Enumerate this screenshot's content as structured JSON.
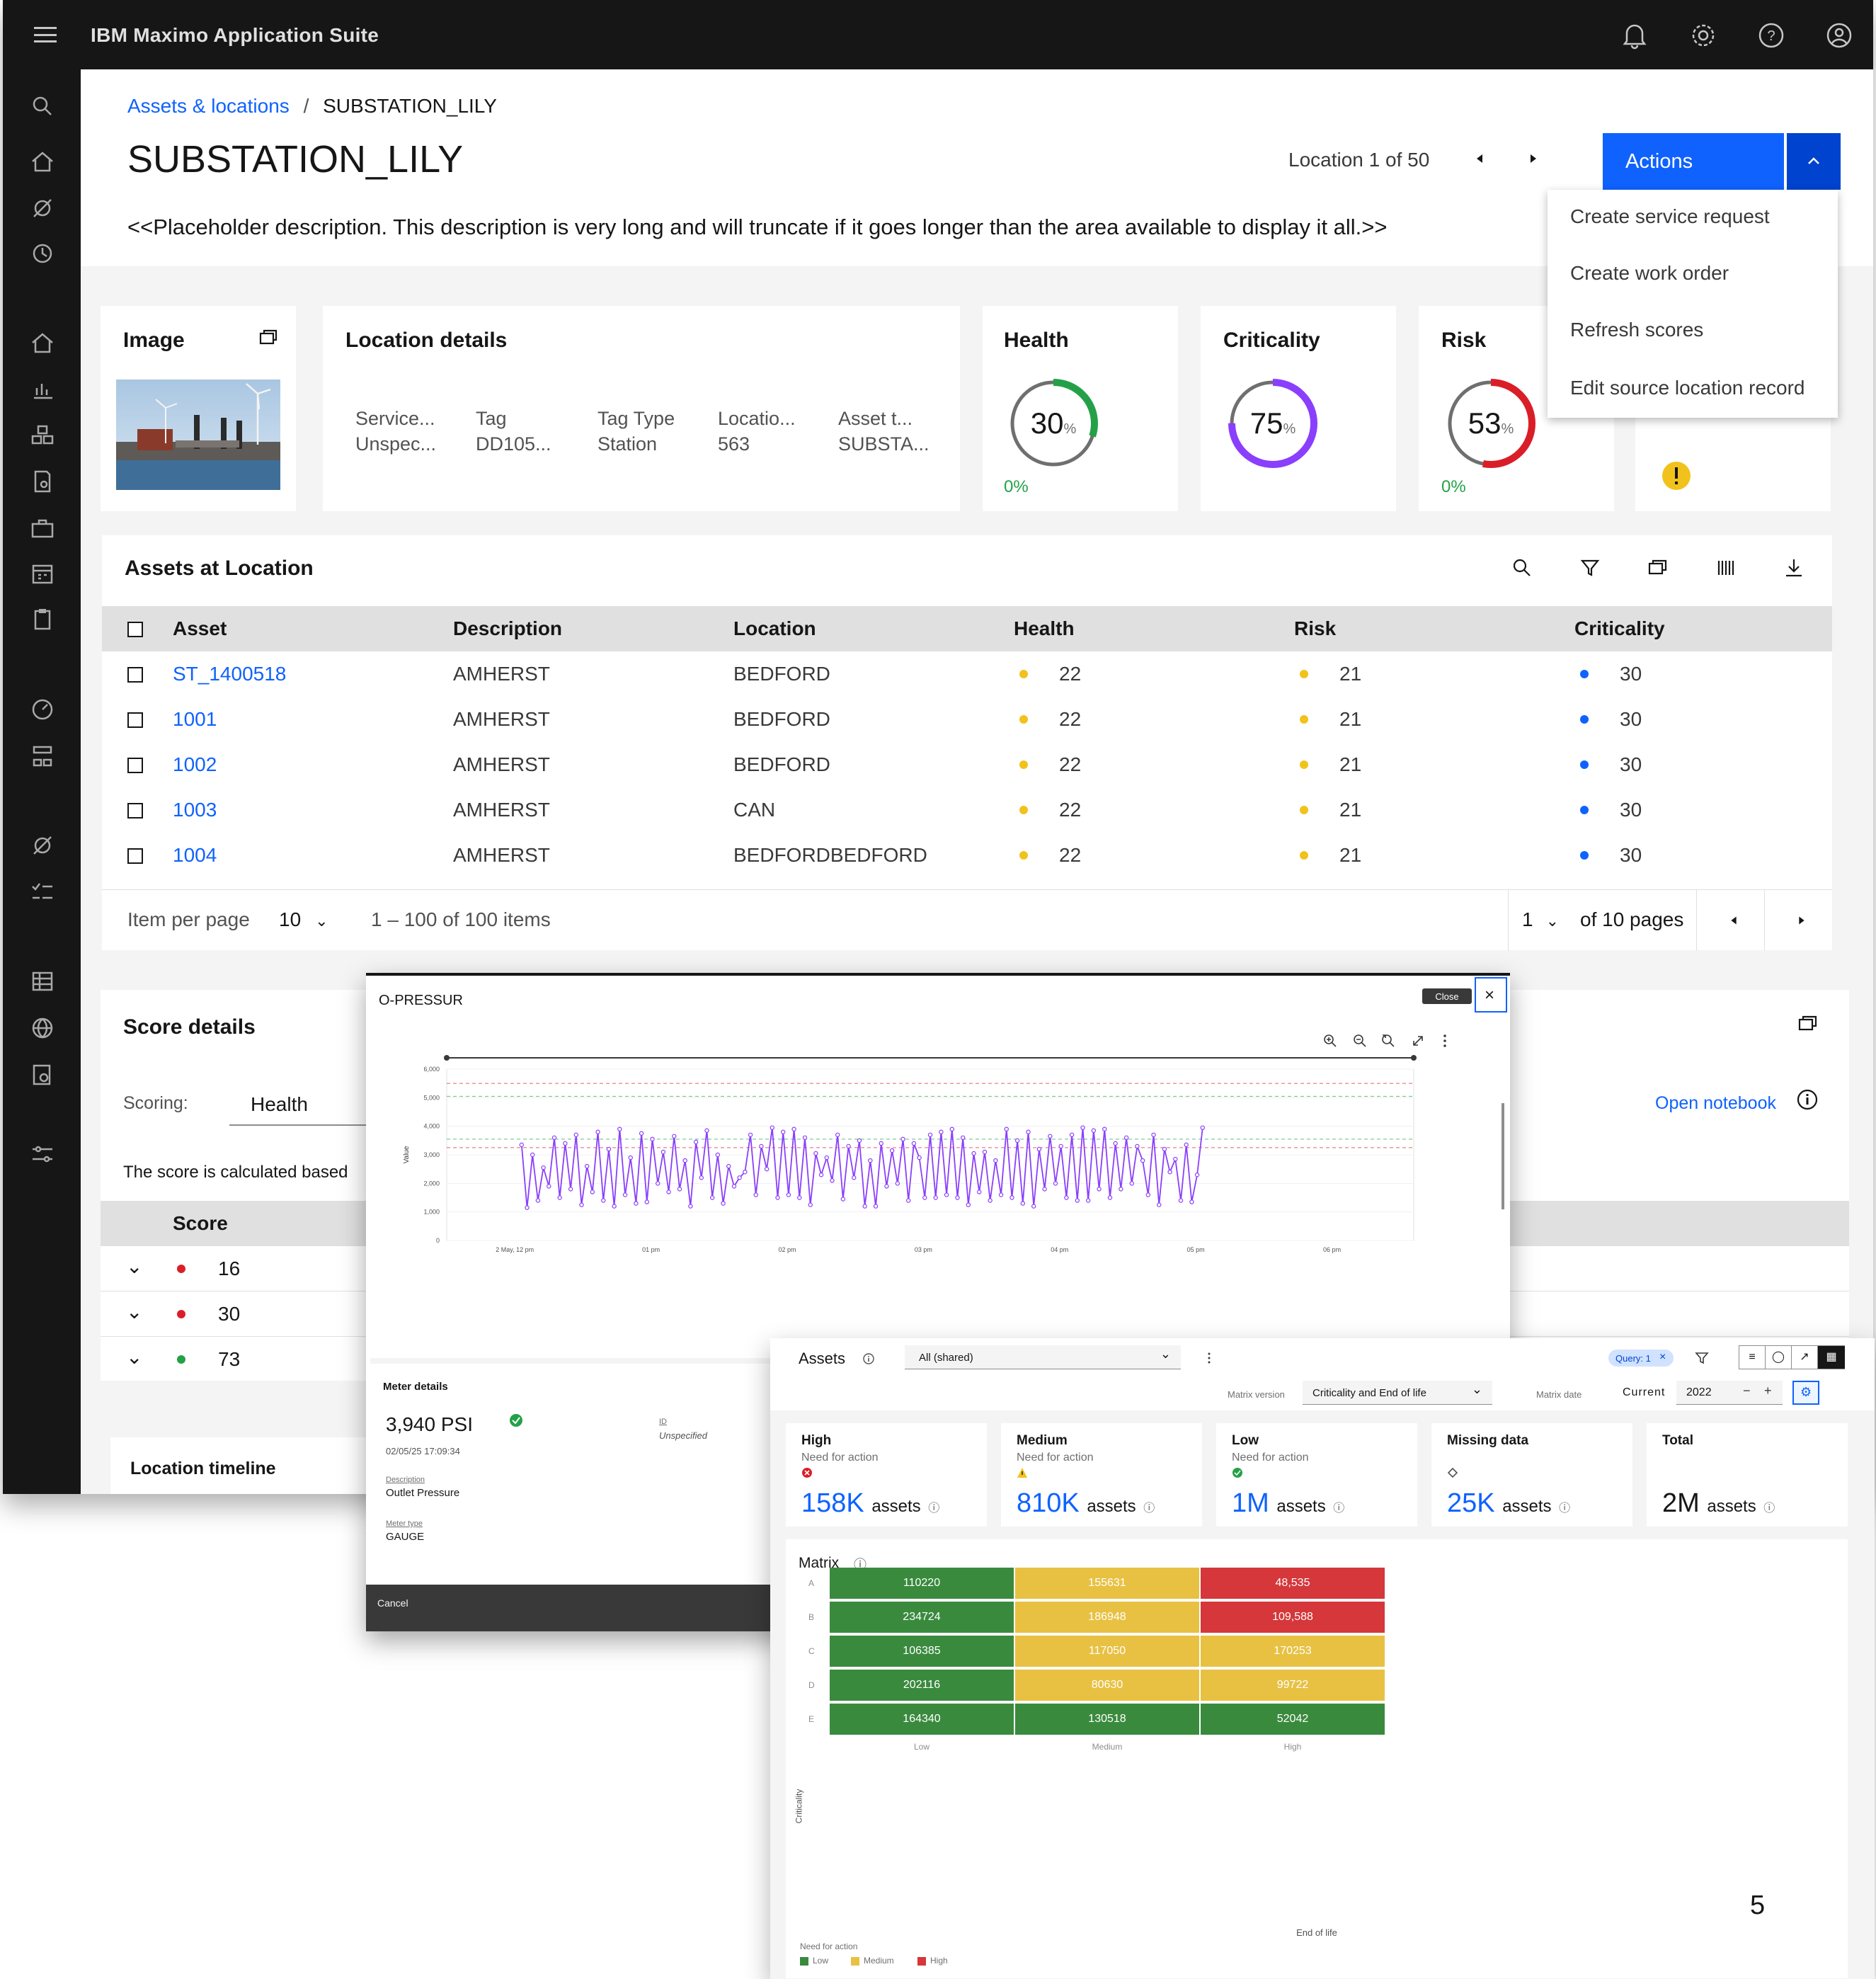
{
  "app": {
    "title": "IBM Maximo Application Suite"
  },
  "breadcrumb": {
    "parent": "Assets & locations",
    "separator": "/",
    "current": "SUBSTATION_LILY"
  },
  "page": {
    "title": "SUBSTATION_LILY",
    "description": "<<Placeholder description. This description is very long and will truncate if it goes longer than the area available to display it all.>>",
    "pager_text": "Location 1 of 50"
  },
  "actions": {
    "button_label": "Actions",
    "menu": [
      "Create service request",
      "Create work order",
      "Refresh scores",
      "Edit source location record"
    ]
  },
  "image_card": {
    "title": "Image"
  },
  "location_details": {
    "title": "Location details",
    "fields": [
      {
        "label": "Service...",
        "value": "Unspec..."
      },
      {
        "label": "Tag",
        "value": "DD105..."
      },
      {
        "label": "Tag Type",
        "value": "Station"
      },
      {
        "label": "Locatio...",
        "value": "563"
      },
      {
        "label": "Asset t...",
        "value": "SUBSTA..."
      }
    ]
  },
  "scores": [
    {
      "title": "Health",
      "value": "30",
      "unit": "%",
      "fraction": 0.3,
      "sub": "0%",
      "color": "#24a148"
    },
    {
      "title": "Criticality",
      "value": "75",
      "unit": "%",
      "fraction": 0.75,
      "sub": "",
      "color": "#8a3ffc"
    },
    {
      "title": "Risk",
      "value": "53",
      "unit": "%",
      "fraction": 0.53,
      "sub": "0%",
      "color": "#da1e28"
    }
  ],
  "assets_table": {
    "title": "Assets at Location",
    "columns": [
      "Asset",
      "Description",
      "Location",
      "Health",
      "Risk",
      "Criticality"
    ],
    "rows": [
      {
        "asset": "ST_1400518",
        "description": "AMHERST",
        "location": "BEDFORD",
        "health": "22",
        "risk": "21",
        "criticality": "30"
      },
      {
        "asset": "1001",
        "description": "AMHERST",
        "location": "BEDFORD",
        "health": "22",
        "risk": "21",
        "criticality": "30"
      },
      {
        "asset": "1002",
        "description": "AMHERST",
        "location": "BEDFORD",
        "health": "22",
        "risk": "21",
        "criticality": "30"
      },
      {
        "asset": "1003",
        "description": "AMHERST",
        "location": "CAN",
        "health": "22",
        "risk": "21",
        "criticality": "30"
      },
      {
        "asset": "1004",
        "description": "AMHERST",
        "location": "BEDFORDBEDFORD",
        "health": "22",
        "risk": "21",
        "criticality": "30"
      }
    ],
    "pagination": {
      "per_page_label": "Item per page",
      "per_page": "10",
      "range": "1 – 100 of 100 items",
      "page": "1",
      "of_pages": "of 10 pages"
    }
  },
  "score_details": {
    "title": "Score details",
    "scoring_label": "Scoring:",
    "tab": "Health",
    "text": "The score is calculated based",
    "col": "Score",
    "rows": [
      {
        "value": "16",
        "color": "#da1e28"
      },
      {
        "value": "30",
        "color": "#da1e28"
      },
      {
        "value": "73",
        "color": "#24a148"
      }
    ],
    "open_notebook": "Open notebook",
    "timeline": "Location timeline"
  },
  "meter": {
    "title": "O-PRESSUR",
    "close_tip": "Close",
    "y_label": "Value",
    "details_title": "Meter details",
    "reading": "3,940 PSI",
    "timestamp": "02/05/25 17:09:34",
    "id_label": "ID",
    "id_value": "Unspecified",
    "desc_label": "Description",
    "desc_value": "Outlet Pressure",
    "type_label": "Meter type",
    "type_value": "GAUGE",
    "cancel": "Cancel"
  },
  "chart_data": {
    "type": "line",
    "ylabel": "Value",
    "ylim": [
      0,
      6000
    ],
    "y_ticks": [
      "0",
      "1,000",
      "2,000",
      "3,000",
      "4,000",
      "5,000",
      "6,000"
    ],
    "x_ticks": [
      "2 May, 12 pm",
      "01 pm",
      "02 pm",
      "03 pm",
      "04 pm",
      "05 pm",
      "06 pm"
    ],
    "xlim_hours": [
      11.5,
      18.6
    ],
    "thresholds": [
      5500,
      5050,
      3550,
      3250
    ],
    "series": [
      {
        "color": "#8a3ffc",
        "x_hours": [
          12.05,
          12.09,
          12.13,
          12.17,
          12.21,
          12.25,
          12.29,
          12.33,
          12.37,
          12.41,
          12.45,
          12.49,
          12.53,
          12.57,
          12.61,
          12.65,
          12.69,
          12.73,
          12.77,
          12.81,
          12.85,
          12.89,
          12.93,
          12.97,
          13.01,
          13.05,
          13.09,
          13.13,
          13.17,
          13.21,
          13.25,
          13.29,
          13.33,
          13.37,
          13.41,
          13.45,
          13.49,
          13.53,
          13.57,
          13.61,
          13.65,
          13.69,
          13.73,
          13.77,
          13.81,
          13.85,
          13.89,
          13.93,
          13.97,
          14.01,
          14.05,
          14.09,
          14.13,
          14.17,
          14.21,
          14.25,
          14.29,
          14.33,
          14.37,
          14.41,
          14.45,
          14.49,
          14.53,
          14.57,
          14.61,
          14.65,
          14.69,
          14.73,
          14.77,
          14.81,
          14.85,
          14.89,
          14.93,
          14.97,
          15.01,
          15.05,
          15.09,
          15.13,
          15.17,
          15.21,
          15.25,
          15.29,
          15.33,
          15.37,
          15.41,
          15.45,
          15.49,
          15.53,
          15.57,
          15.61,
          15.65,
          15.69,
          15.73,
          15.77,
          15.81,
          15.85,
          15.89,
          15.93,
          15.97,
          16.01,
          16.05,
          16.09,
          16.13,
          16.17,
          16.21,
          16.25,
          16.29,
          16.33,
          16.37,
          16.41,
          16.45,
          16.49,
          16.53,
          16.57,
          16.61,
          16.65,
          16.69,
          16.73,
          16.77,
          16.81,
          16.85,
          16.89,
          16.93,
          16.97,
          17.01,
          17.05,
          17.09,
          17.13,
          17.17
        ],
        "values": [
          3350,
          1150,
          3000,
          1400,
          2550,
          1900,
          3600,
          1500,
          3400,
          1800,
          3700,
          1250,
          2600,
          1700,
          3800,
          1400,
          3200,
          1200,
          3900,
          1600,
          2900,
          1300,
          3750,
          1350,
          3550,
          2000,
          3100,
          1700,
          3650,
          1800,
          2800,
          1200,
          3450,
          2200,
          3850,
          1500,
          3000,
          1300,
          2600,
          1900,
          2200,
          2400,
          3700,
          1600,
          3300,
          2500,
          3950,
          1500,
          3800,
          1600,
          3900,
          1500,
          3600,
          1250,
          3050,
          2300,
          2900,
          2100,
          3700,
          1450,
          3300,
          2200,
          3500,
          1200,
          2800,
          1200,
          3400,
          1900,
          3150,
          2000,
          3550,
          1400,
          3400,
          2900,
          1500,
          3700,
          1500,
          3800,
          1600,
          3900,
          1500,
          3600,
          1250,
          3050,
          1700,
          3100,
          1400,
          2800,
          1600,
          3900,
          1500,
          3500,
          1300,
          3800,
          1200,
          3200,
          1800,
          3650,
          2000,
          3300,
          1500,
          3700,
          1400,
          3950,
          1400,
          3850,
          1800,
          3900,
          1500,
          3400,
          1800,
          3600,
          2000,
          3300,
          2800,
          1600,
          3700,
          1250,
          3200,
          2400,
          2850,
          1400,
          3350,
          1350,
          2300,
          3950
        ]
      }
    ]
  },
  "matrix": {
    "assets_label": "Assets",
    "filter_value": "All (shared)",
    "query_tag": "Query: 1",
    "version_label": "Matrix version",
    "version_value": "Criticality and End of life",
    "date_label": "Matrix date",
    "current_label": "Current",
    "year": "2022",
    "kpis": [
      {
        "title": "High",
        "sub": "Need for action",
        "value": "158K",
        "unit": "assets",
        "color": "#da1e28"
      },
      {
        "title": "Medium",
        "sub": "Need for action",
        "value": "810K",
        "unit": "assets",
        "color": "#f1c21b"
      },
      {
        "title": "Low",
        "sub": "Need for action",
        "value": "1M",
        "unit": "assets",
        "color": "#24a148"
      },
      {
        "title": "Missing data",
        "sub": "",
        "value": "25K",
        "unit": "assets",
        "color": "#6f6f6f"
      },
      {
        "title": "Total",
        "sub": "",
        "value": "2M",
        "unit": "assets",
        "color": ""
      }
    ],
    "matrix_title": "Matrix",
    "rows": [
      "A",
      "B",
      "C",
      "D",
      "E"
    ],
    "cols": [
      "Low",
      "Medium",
      "High"
    ],
    "y_axis": "Criticality",
    "x_axis": "End of life",
    "values": [
      [
        "110220",
        "155631",
        "48,535"
      ],
      [
        "234724",
        "186948",
        "109,588"
      ],
      [
        "106385",
        "117050",
        "170253"
      ],
      [
        "202116",
        "80630",
        "99722"
      ],
      [
        "164340",
        "130518",
        "52042"
      ]
    ],
    "levels": [
      [
        "low",
        "medium",
        "high"
      ],
      [
        "low",
        "medium",
        "high"
      ],
      [
        "low",
        "medium",
        "medium"
      ],
      [
        "low",
        "medium",
        "medium"
      ],
      [
        "low",
        "low",
        "low"
      ]
    ],
    "colors": {
      "low": "#3a8a3e",
      "medium": "#e8c143",
      "high": "#d5373a"
    },
    "legend_title": "Need for action",
    "legend": [
      "Low",
      "Medium",
      "High"
    ]
  },
  "page_number": "5"
}
